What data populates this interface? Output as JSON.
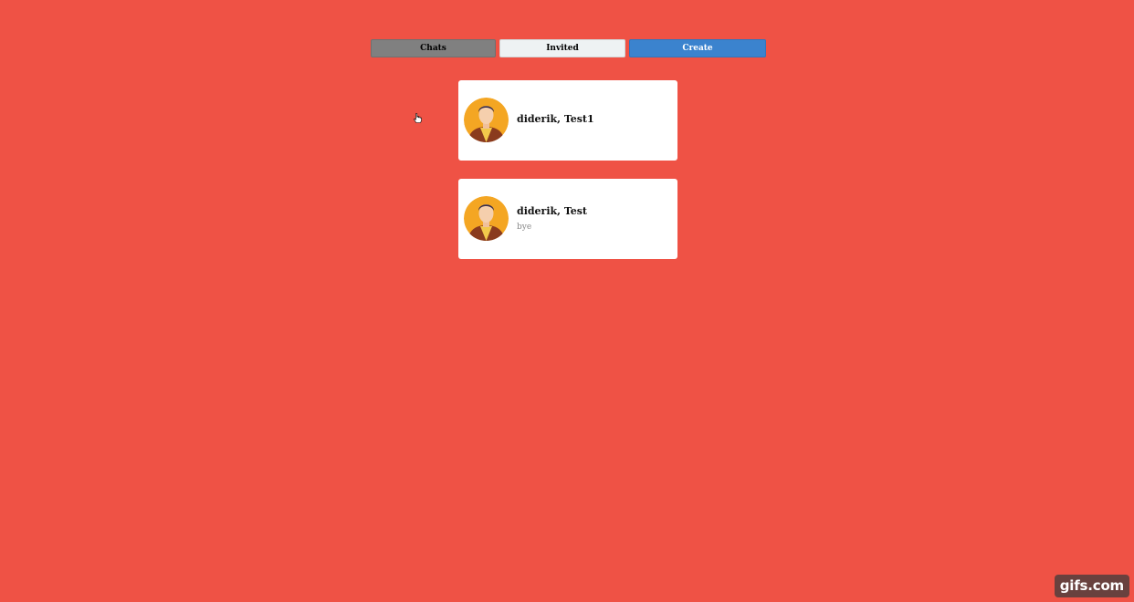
{
  "tabs": {
    "chats_label": "Chats",
    "invited_label": "Invited",
    "create_label": "Create"
  },
  "chats": [
    {
      "title": "diderik, Test1",
      "preview": "",
      "avatar": "user-avatar-icon"
    },
    {
      "title": "diderik, Test",
      "preview": "bye",
      "avatar": "user-avatar-icon"
    }
  ],
  "watermark": "gifs.com",
  "colors": {
    "background": "#ef5245",
    "tab_chats": "#808080",
    "tab_invited": "#eef2f3",
    "tab_create": "#3b83ce",
    "card": "#ffffff"
  }
}
